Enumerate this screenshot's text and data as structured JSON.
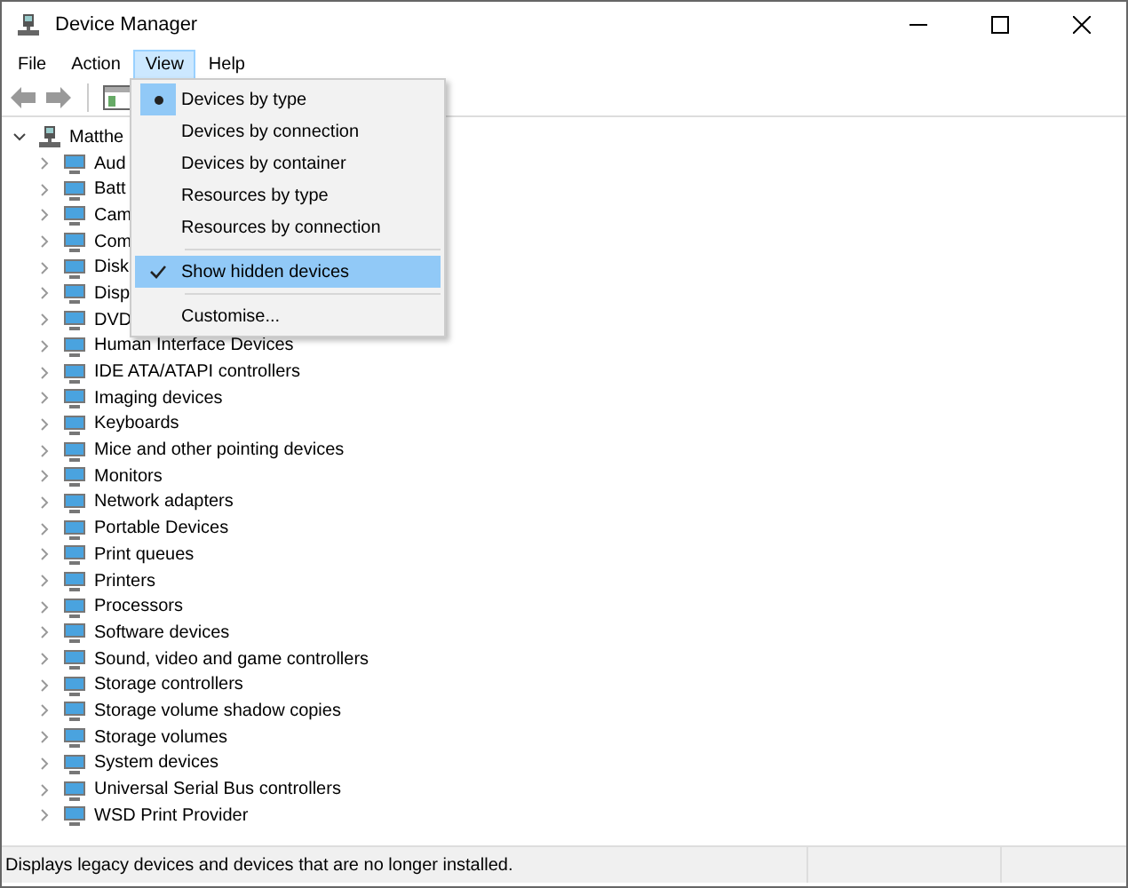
{
  "window": {
    "title": "Device Manager"
  },
  "menu_bar": [
    {
      "label": "File",
      "selected": false
    },
    {
      "label": "Action",
      "selected": false
    },
    {
      "label": "View",
      "selected": true
    },
    {
      "label": "Help",
      "selected": false
    }
  ],
  "view_menu": [
    {
      "kind": "radio",
      "label": "Devices by type",
      "checked": true,
      "selected": false
    },
    {
      "kind": "radio",
      "label": "Devices by connection",
      "checked": false,
      "selected": false
    },
    {
      "kind": "radio",
      "label": "Devices by container",
      "checked": false,
      "selected": false
    },
    {
      "kind": "radio",
      "label": "Resources by type",
      "checked": false,
      "selected": false
    },
    {
      "kind": "radio",
      "label": "Resources by connection",
      "checked": false,
      "selected": false
    },
    {
      "kind": "separator"
    },
    {
      "kind": "check",
      "label": "Show hidden devices",
      "checked": true,
      "selected": true
    },
    {
      "kind": "separator"
    },
    {
      "kind": "plain",
      "label": "Customise...",
      "selected": false
    }
  ],
  "tree": {
    "label": "Matthe",
    "expanded": true,
    "children": [
      {
        "label": "Aud",
        "expanded": false
      },
      {
        "label": "Batt",
        "expanded": false
      },
      {
        "label": "Cam",
        "expanded": false
      },
      {
        "label": "Com",
        "expanded": false
      },
      {
        "label": "Disk",
        "expanded": false
      },
      {
        "label": "Disp",
        "expanded": false
      },
      {
        "label": "DVD",
        "expanded": false
      },
      {
        "label": "Human Interface Devices",
        "expanded": false
      },
      {
        "label": "IDE ATA/ATAPI controllers",
        "expanded": false
      },
      {
        "label": "Imaging devices",
        "expanded": false
      },
      {
        "label": "Keyboards",
        "expanded": false
      },
      {
        "label": "Mice and other pointing devices",
        "expanded": false
      },
      {
        "label": "Monitors",
        "expanded": false
      },
      {
        "label": "Network adapters",
        "expanded": false
      },
      {
        "label": "Portable Devices",
        "expanded": false
      },
      {
        "label": "Print queues",
        "expanded": false
      },
      {
        "label": "Printers",
        "expanded": false
      },
      {
        "label": "Processors",
        "expanded": false
      },
      {
        "label": "Software devices",
        "expanded": false
      },
      {
        "label": "Sound, video and game controllers",
        "expanded": false
      },
      {
        "label": "Storage controllers",
        "expanded": false
      },
      {
        "label": "Storage volume shadow copies",
        "expanded": false
      },
      {
        "label": "Storage volumes",
        "expanded": false
      },
      {
        "label": "System devices",
        "expanded": false
      },
      {
        "label": "Universal Serial Bus controllers",
        "expanded": false
      },
      {
        "label": "WSD Print Provider",
        "expanded": false
      }
    ]
  },
  "status_bar": "Displays legacy devices and devices that are no longer installed."
}
